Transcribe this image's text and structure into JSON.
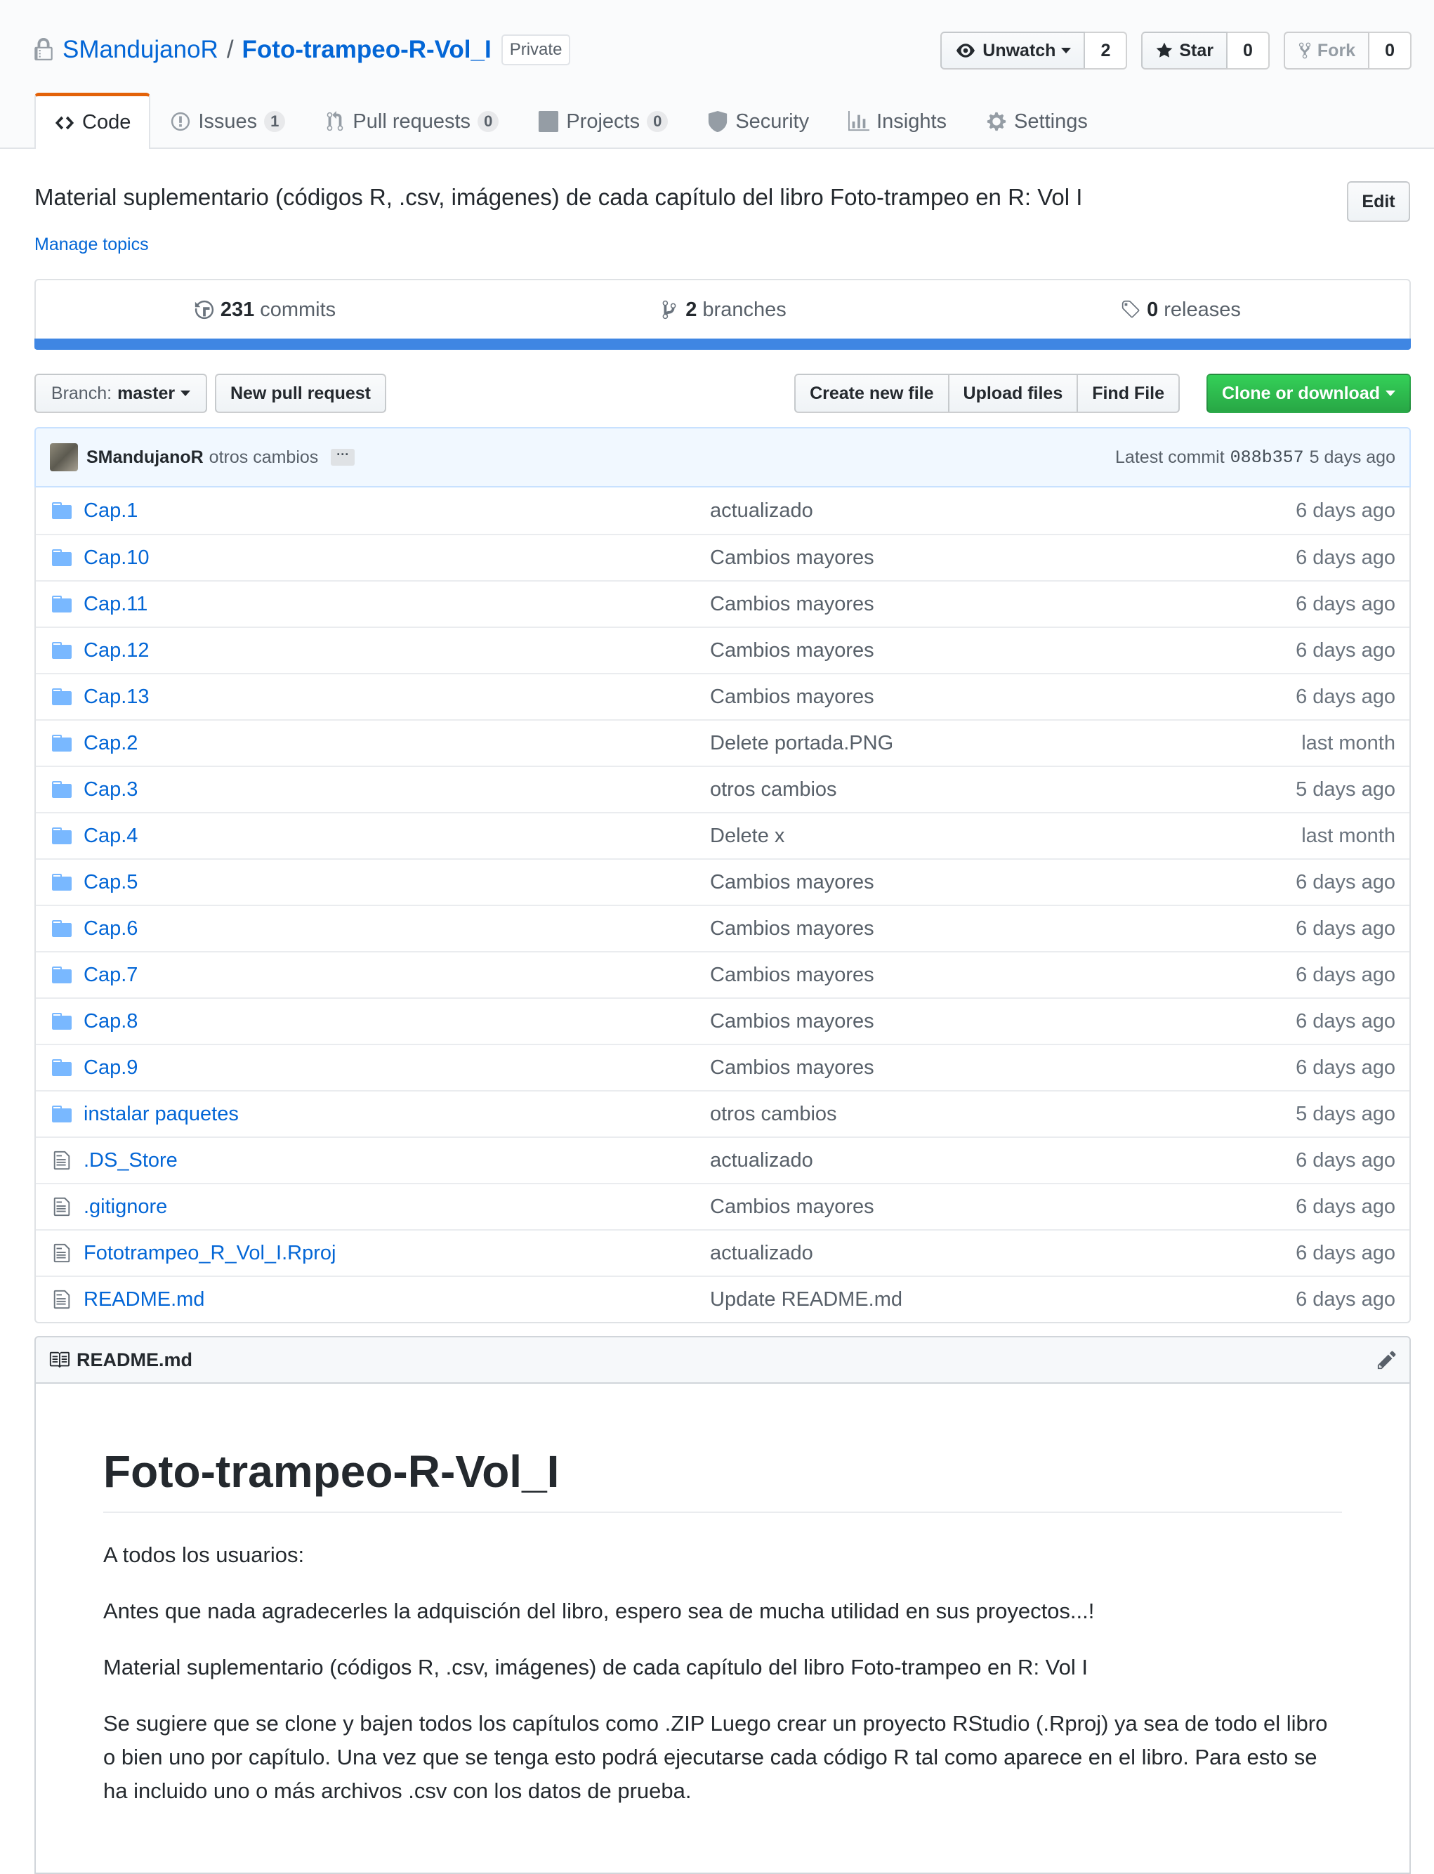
{
  "repo": {
    "owner": "SMandujanoR",
    "separator": "/",
    "name": "Foto-trampeo-R-Vol_I",
    "visibility": "Private"
  },
  "actions": {
    "watch_label": "Unwatch",
    "watch_count": "2",
    "star_label": "Star",
    "star_count": "0",
    "fork_label": "Fork",
    "fork_count": "0"
  },
  "nav": {
    "code": "Code",
    "issues": "Issues",
    "issues_count": "1",
    "pulls": "Pull requests",
    "pulls_count": "0",
    "projects": "Projects",
    "projects_count": "0",
    "security": "Security",
    "insights": "Insights",
    "settings": "Settings"
  },
  "description": "Material suplementario (códigos R, .csv, imágenes) de cada capítulo del libro Foto-trampeo en R: Vol I",
  "edit_label": "Edit",
  "manage_topics": "Manage topics",
  "summary": {
    "commits_num": "231",
    "commits_label": "commits",
    "branches_num": "2",
    "branches_label": "branches",
    "releases_num": "0",
    "releases_label": "releases",
    "language_color": "#3f86e3"
  },
  "filenav": {
    "branch_prefix": "Branch:",
    "branch_name": "master",
    "new_pr": "New pull request",
    "create_file": "Create new file",
    "upload_files": "Upload files",
    "find_file": "Find File",
    "clone": "Clone or download"
  },
  "commit": {
    "author": "SMandujanoR",
    "message": "otros cambios",
    "ellipsis": "···",
    "latest_label": "Latest commit",
    "sha": "088b357",
    "age": "5 days ago"
  },
  "files": [
    {
      "type": "folder",
      "name": "Cap.1",
      "message": "actualizado",
      "age": "6 days ago"
    },
    {
      "type": "folder",
      "name": "Cap.10",
      "message": "Cambios mayores",
      "age": "6 days ago"
    },
    {
      "type": "folder",
      "name": "Cap.11",
      "message": "Cambios mayores",
      "age": "6 days ago"
    },
    {
      "type": "folder",
      "name": "Cap.12",
      "message": "Cambios mayores",
      "age": "6 days ago"
    },
    {
      "type": "folder",
      "name": "Cap.13",
      "message": "Cambios mayores",
      "age": "6 days ago"
    },
    {
      "type": "folder",
      "name": "Cap.2",
      "message": "Delete portada.PNG",
      "age": "last month"
    },
    {
      "type": "folder",
      "name": "Cap.3",
      "message": "otros cambios",
      "age": "5 days ago"
    },
    {
      "type": "folder",
      "name": "Cap.4",
      "message": "Delete x",
      "age": "last month"
    },
    {
      "type": "folder",
      "name": "Cap.5",
      "message": "Cambios mayores",
      "age": "6 days ago"
    },
    {
      "type": "folder",
      "name": "Cap.6",
      "message": "Cambios mayores",
      "age": "6 days ago"
    },
    {
      "type": "folder",
      "name": "Cap.7",
      "message": "Cambios mayores",
      "age": "6 days ago"
    },
    {
      "type": "folder",
      "name": "Cap.8",
      "message": "Cambios mayores",
      "age": "6 days ago"
    },
    {
      "type": "folder",
      "name": "Cap.9",
      "message": "Cambios mayores",
      "age": "6 days ago"
    },
    {
      "type": "folder",
      "name": "instalar paquetes",
      "message": "otros cambios",
      "age": "5 days ago"
    },
    {
      "type": "file",
      "name": ".DS_Store",
      "message": "actualizado",
      "age": "6 days ago"
    },
    {
      "type": "file",
      "name": ".gitignore",
      "message": "Cambios mayores",
      "age": "6 days ago"
    },
    {
      "type": "file",
      "name": "Fototrampeo_R_Vol_I.Rproj",
      "message": "actualizado",
      "age": "6 days ago"
    },
    {
      "type": "file",
      "name": "README.md",
      "message": "Update README.md",
      "age": "6 days ago"
    }
  ],
  "readme": {
    "filename": "README.md",
    "title": "Foto-trampeo-R-Vol_I",
    "paragraphs": [
      "A todos los usuarios:",
      "Antes que nada agradecerles la adquisción del libro, espero sea de mucha utilidad en sus proyectos...!",
      "Material suplementario (códigos R, .csv, imágenes) de cada capítulo del libro Foto-trampeo en R: Vol I",
      "Se sugiere que se clone y bajen todos los capítulos como .ZIP Luego crear un proyecto RStudio (.Rproj) ya sea de todo el libro o bien uno por capítulo. Una vez que se tenga esto podrá ejecutarse cada código R tal como aparece en el libro. Para esto se ha incluido uno o más archivos .csv con los datos de prueba."
    ]
  },
  "icons": {
    "lock": "lock-icon",
    "eye": "eye-icon",
    "star": "star-icon",
    "fork": "repo-forked-icon",
    "code": "code-icon",
    "issue": "issue-opened-icon",
    "pr": "git-pull-request-icon",
    "project": "project-icon",
    "shield": "shield-icon",
    "graph": "graph-icon",
    "gear": "gear-icon",
    "history": "history-icon",
    "branch": "git-branch-icon",
    "tag": "tag-icon",
    "folder": "file-directory-icon",
    "file": "file-icon",
    "book": "book-icon",
    "pencil": "pencil-icon"
  }
}
